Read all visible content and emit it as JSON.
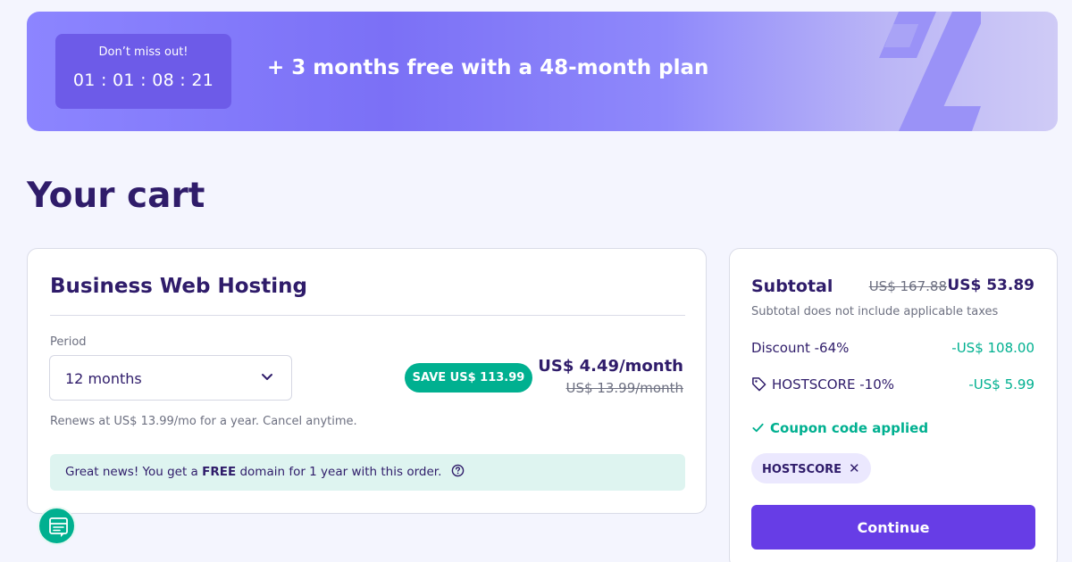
{
  "banner": {
    "timer_label": "Don’t miss out!",
    "timer_value": "01 : 01 : 08 : 21",
    "headline": "+ 3 months free with a 48-month plan"
  },
  "page": {
    "title": "Your cart"
  },
  "product": {
    "title": "Business Web Hosting",
    "period_label": "Period",
    "period_value": "12 months",
    "save_badge": "SAVE US$ 113.99",
    "price_now": "US$ 4.49/month",
    "price_old": "US$ 13.99/month",
    "renew_text": "Renews at US$ 13.99/mo for a year. Cancel anytime.",
    "domain_note_before": "Great news! You get a ",
    "domain_note_bold": "FREE",
    "domain_note_after": " domain for 1 year with this order."
  },
  "summary": {
    "subtotal_label": "Subtotal",
    "subtotal_old": "US$ 167.88",
    "subtotal_new": "US$ 53.89",
    "tax_note": "Subtotal does not include applicable taxes",
    "discount_label": "Discount -64%",
    "discount_value": "-US$ 108.00",
    "coupon_label": "HOSTSCORE -10%",
    "coupon_value": "-US$ 5.99",
    "coupon_applied": "Coupon code applied",
    "coupon_chip": "HOSTSCORE",
    "continue_label": "Continue"
  },
  "colors": {
    "brand": "#673de6",
    "success": "#00b090",
    "heading": "#2f1c6a"
  },
  "icons": {
    "banner": "percent-icon",
    "select": "chevron-down-icon",
    "help": "question-circle-icon",
    "tag": "tag-icon",
    "check": "check-icon",
    "remove": "close-icon",
    "chat": "chat-icon"
  }
}
